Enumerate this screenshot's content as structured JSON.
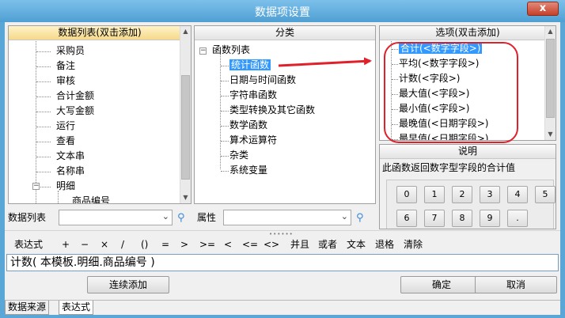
{
  "window": {
    "title": "数据项设置",
    "close_label": "x"
  },
  "data_list": {
    "header": "数据列表(双击添加)",
    "items": [
      "采购员",
      "备注",
      "审核",
      "合计金额",
      "大写金额",
      "运行",
      "查看",
      "文本串",
      "名称串",
      "明细",
      "商品编号"
    ],
    "expander_open": "−"
  },
  "category": {
    "header": "分类",
    "root": "函数列表",
    "items": [
      "统计函数",
      "日期与时间函数",
      "字符串函数",
      "类型转换及其它函数",
      "数学函数",
      "算术运算符",
      "杂类",
      "系统变量"
    ],
    "selected": "统计函数"
  },
  "options": {
    "header": "选项(双击添加)",
    "items": [
      "合计(<数字字段>)",
      "平均(<数字字段>)",
      "计数(<字段>)",
      "最大值(<字段>)",
      "最小值(<字段>)",
      "最晚值(<日期字段>)",
      "最早值(<日期字段>)"
    ]
  },
  "explain": {
    "header": "说明",
    "text": "此函数返回数字型字段的合计值"
  },
  "keypad": [
    "0",
    "1",
    "2",
    "3",
    "4",
    "5",
    "6",
    "7",
    "8",
    "9",
    "."
  ],
  "filters": {
    "list_label": "数据列表",
    "attr_label": "属性",
    "list_value": "",
    "attr_value": ""
  },
  "toolbar": [
    "表达式",
    "+",
    "−",
    "×",
    "/",
    "()",
    "=",
    ">",
    ">=",
    "<",
    "<=",
    "<>",
    "并且",
    "或者",
    "文本",
    "退格",
    "清除"
  ],
  "expression": "计数( 本模板.明细.商品编号 )",
  "buttons": {
    "continuous_add": "连续添加",
    "ok": "确定",
    "cancel": "取消"
  },
  "tabs": [
    "数据来源",
    "表达式"
  ],
  "colors": {
    "selection": "#3399ff",
    "annotation": "#e0202a",
    "title_bar": "#5aa6d6"
  }
}
